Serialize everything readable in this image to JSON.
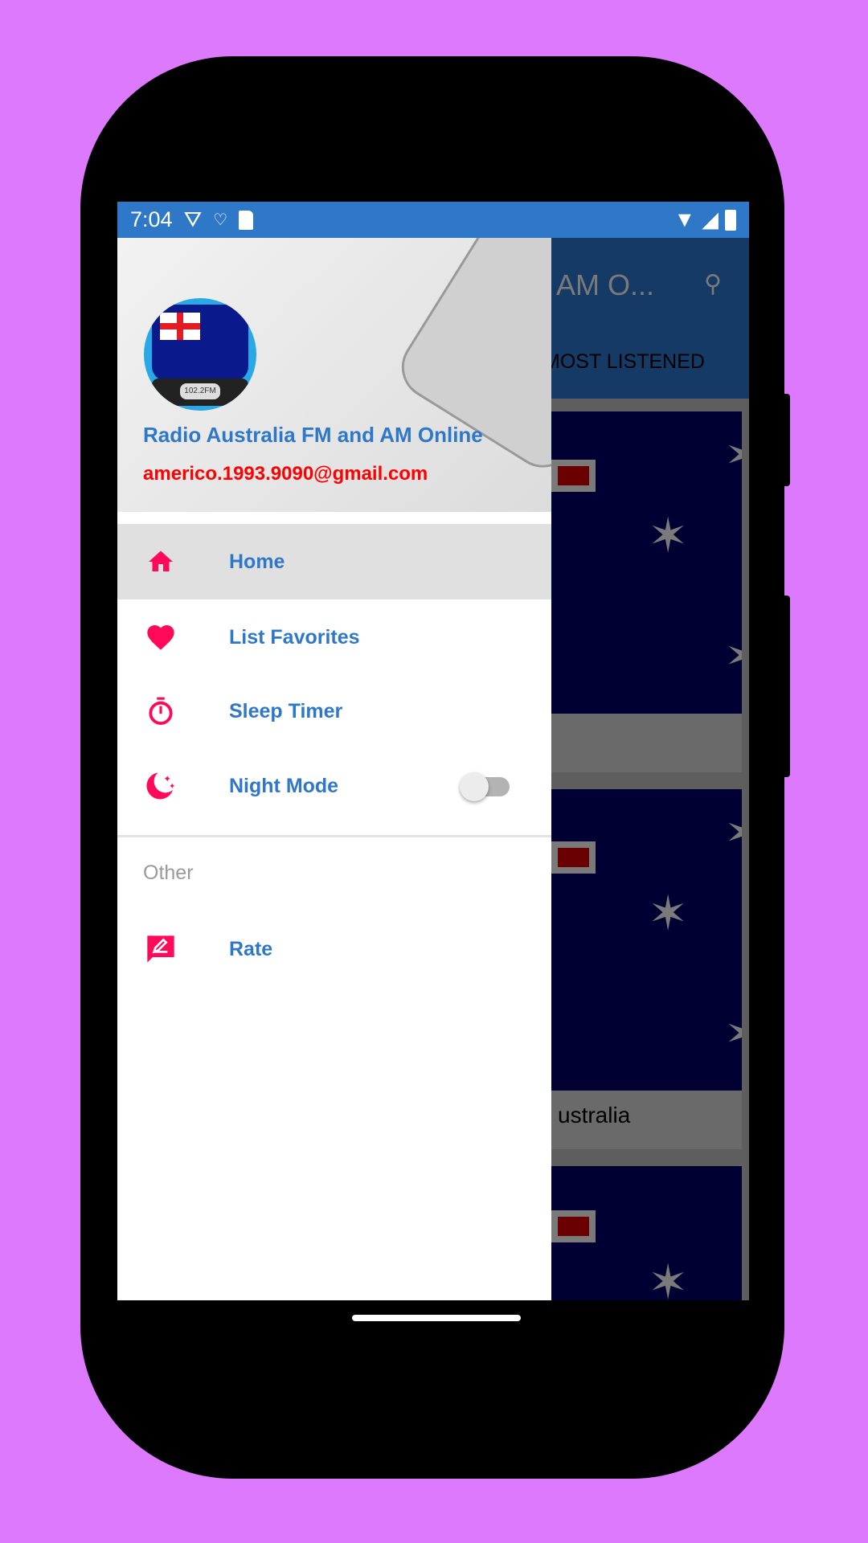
{
  "status_bar": {
    "time": "7:04",
    "left_icons": [
      "shield-play-icon",
      "accessibility-icon",
      "sd-card-icon"
    ],
    "right_icons": [
      "wifi-icon",
      "signal-icon",
      "battery-icon"
    ]
  },
  "app_bar": {
    "title": "l AM O...",
    "tab": "MOST LISTENED",
    "search_icon": "search-icon"
  },
  "cards": [
    {
      "caption": ""
    },
    {
      "caption": "ustralia"
    },
    {
      "caption": ""
    }
  ],
  "drawer": {
    "title": "Radio Australia FM and AM Online",
    "email": "americo.1993.9090@gmail.com",
    "avatar_text": "102.2FM",
    "items": [
      {
        "label": "Home",
        "icon": "home-icon",
        "selected": true
      },
      {
        "label": "List Favorites",
        "icon": "heart-icon"
      },
      {
        "label": "Sleep Timer",
        "icon": "timer-icon"
      },
      {
        "label": "Night Mode",
        "icon": "moon-icon",
        "toggle": false
      }
    ],
    "section": "Other",
    "other_items": [
      {
        "label": "Rate",
        "icon": "rate-icon"
      }
    ]
  },
  "colors": {
    "accent": "#2f78c8",
    "icon": "#ff0a5a",
    "email": "#ff0000",
    "background": "#dc79fd"
  }
}
